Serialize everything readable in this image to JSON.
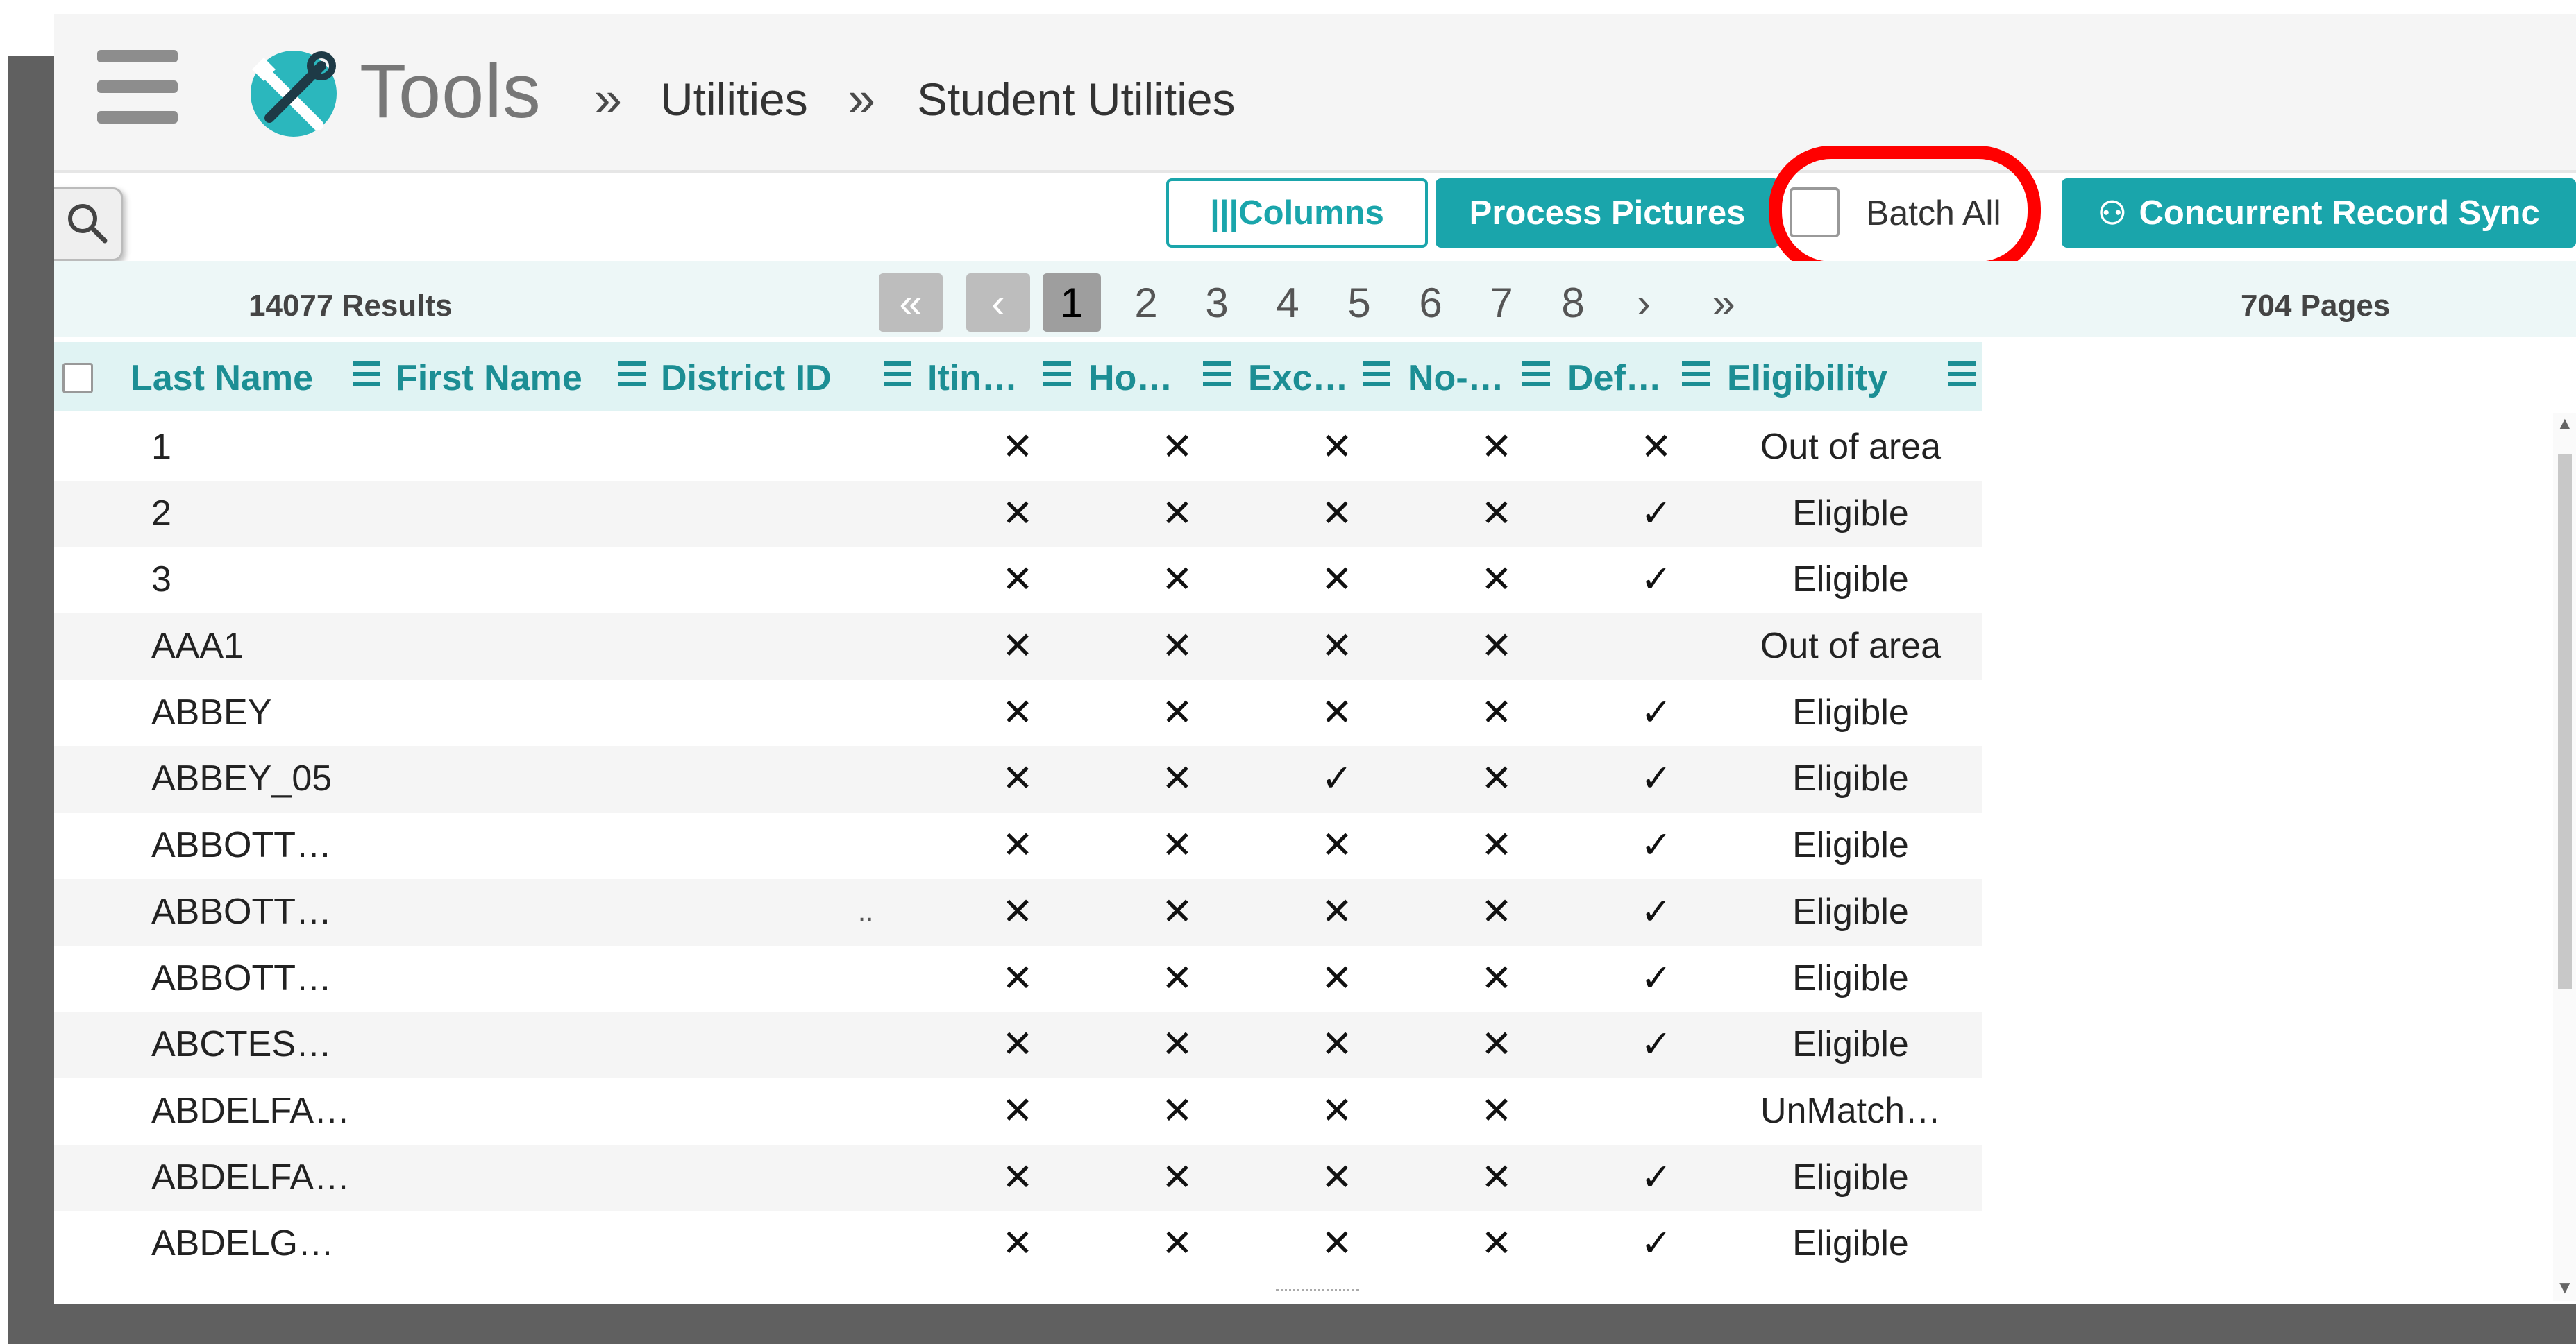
{
  "app": {
    "brand": "Tools",
    "breadcrumb_sep": "»",
    "breadcrumb": [
      "Utilities",
      "Student Utilities"
    ],
    "menu_icon": "hamburger-icon",
    "search_icon": "search-icon"
  },
  "toolbar": {
    "columns_label": "|||Columns",
    "process_pictures_label": "Process Pictures",
    "batch_all_label": "Batch All",
    "concurrent_sync_label": "Concurrent Record Sync",
    "batch_all_checked": false
  },
  "pagination": {
    "results": "14077 Results",
    "pages_count": "704 Pages",
    "first": "«",
    "prev": "‹",
    "next": "›",
    "last": "»",
    "pages": [
      "1",
      "2",
      "3",
      "4",
      "5",
      "6",
      "7",
      "8"
    ],
    "active": "1"
  },
  "table": {
    "columns": [
      "Last Name",
      "First Name",
      "District ID",
      "Itin…",
      "Ho…",
      "Exc…",
      "No-…",
      "Def…",
      "Eligibility"
    ],
    "rows": [
      {
        "last_name": "1",
        "itin": "x",
        "ho": "x",
        "exc": "x",
        "no": "x",
        "def": "x",
        "eligibility": "Out of area"
      },
      {
        "last_name": "2",
        "itin": "x",
        "ho": "x",
        "exc": "x",
        "no": "x",
        "def": "check",
        "eligibility": "Eligible"
      },
      {
        "last_name": "3",
        "itin": "x",
        "ho": "x",
        "exc": "x",
        "no": "x",
        "def": "check",
        "eligibility": "Eligible"
      },
      {
        "last_name": "AAA1",
        "itin": "x",
        "ho": "x",
        "exc": "x",
        "no": "x",
        "def": "",
        "eligibility": "Out of area"
      },
      {
        "last_name": "ABBEY",
        "itin": "x",
        "ho": "x",
        "exc": "x",
        "no": "x",
        "def": "check",
        "eligibility": "Eligible"
      },
      {
        "last_name": "ABBEY_05",
        "itin": "x",
        "ho": "x",
        "exc": "check",
        "no": "x",
        "def": "check",
        "eligibility": "Eligible"
      },
      {
        "last_name": "ABBOTT…",
        "itin": "x",
        "ho": "x",
        "exc": "x",
        "no": "x",
        "def": "check",
        "eligibility": "Eligible"
      },
      {
        "last_name": "ABBOTT…",
        "itin": "x",
        "ho": "x",
        "exc": "x",
        "no": "x",
        "def": "check",
        "eligibility": "Eligible",
        "stray": ".."
      },
      {
        "last_name": "ABBOTT…",
        "itin": "x",
        "ho": "x",
        "exc": "x",
        "no": "x",
        "def": "check",
        "eligibility": "Eligible"
      },
      {
        "last_name": "ABCTES…",
        "itin": "x",
        "ho": "x",
        "exc": "x",
        "no": "x",
        "def": "check",
        "eligibility": "Eligible"
      },
      {
        "last_name": "ABDELFA…",
        "itin": "x",
        "ho": "x",
        "exc": "x",
        "no": "x",
        "def": "",
        "eligibility": "UnMatch…"
      },
      {
        "last_name": "ABDELFA…",
        "itin": "x",
        "ho": "x",
        "exc": "x",
        "no": "x",
        "def": "check",
        "eligibility": "Eligible"
      },
      {
        "last_name": "ABDELG…",
        "itin": "x",
        "ho": "x",
        "exc": "x",
        "no": "x",
        "def": "check",
        "eligibility": "Eligible"
      }
    ]
  },
  "colors": {
    "accent": "#1aa5ab",
    "header_text": "#1c8e94",
    "highlight": "#ff0000"
  }
}
